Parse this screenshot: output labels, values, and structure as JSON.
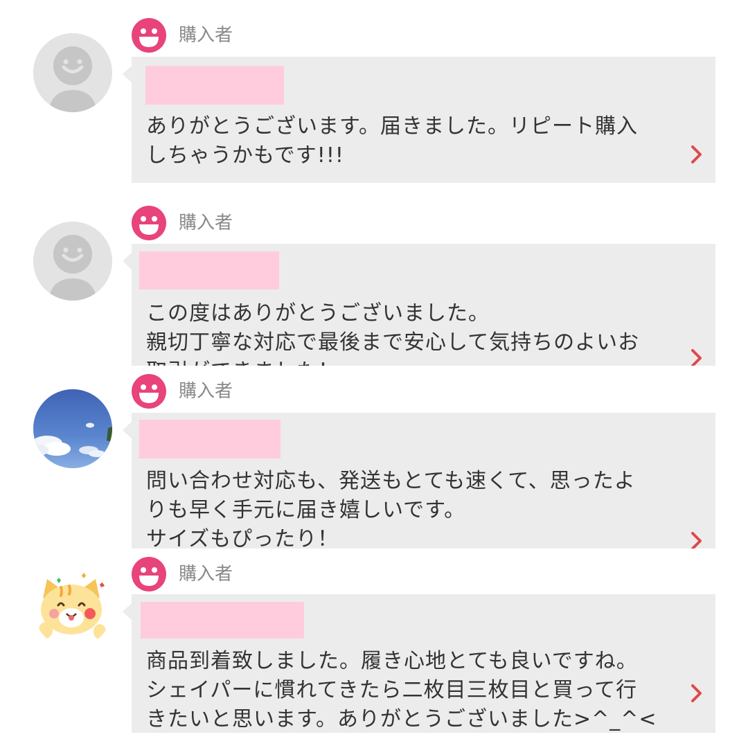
{
  "reviews": [
    {
      "role": "購入者",
      "avatar_icon": "default-person-icon",
      "message": "ありがとうございます。届きました。リピート購入\nしちゃうかもです!!!"
    },
    {
      "role": "購入者",
      "avatar_icon": "default-person-icon",
      "message": "この度はありがとうございました。\n親切丁寧な対応で最後まで安心して気持ちのよいお\n取引ができました！"
    },
    {
      "role": "購入者",
      "avatar_icon": "sky-photo-avatar",
      "message": "問い合わせ対応も、発送もとても速くて、思ったよ\nりも早く手元に届き嬉しいです。\nサイズもぴったり！"
    },
    {
      "role": "購入者",
      "avatar_icon": "cat-sticker-avatar",
      "message": "商品到着致しました。履き心地とても良いですね。\nシェイパーに慣れてきたら二枚目三枚目と買って行\nきたいと思います。ありがとうございました>^_^<"
    }
  ],
  "colors": {
    "smile_icon": "#e8437a",
    "bubble_bg": "#ececec",
    "redaction": "#ffccdd",
    "chevron": "#e04848",
    "role_text": "#888888",
    "message_text": "#333333"
  }
}
